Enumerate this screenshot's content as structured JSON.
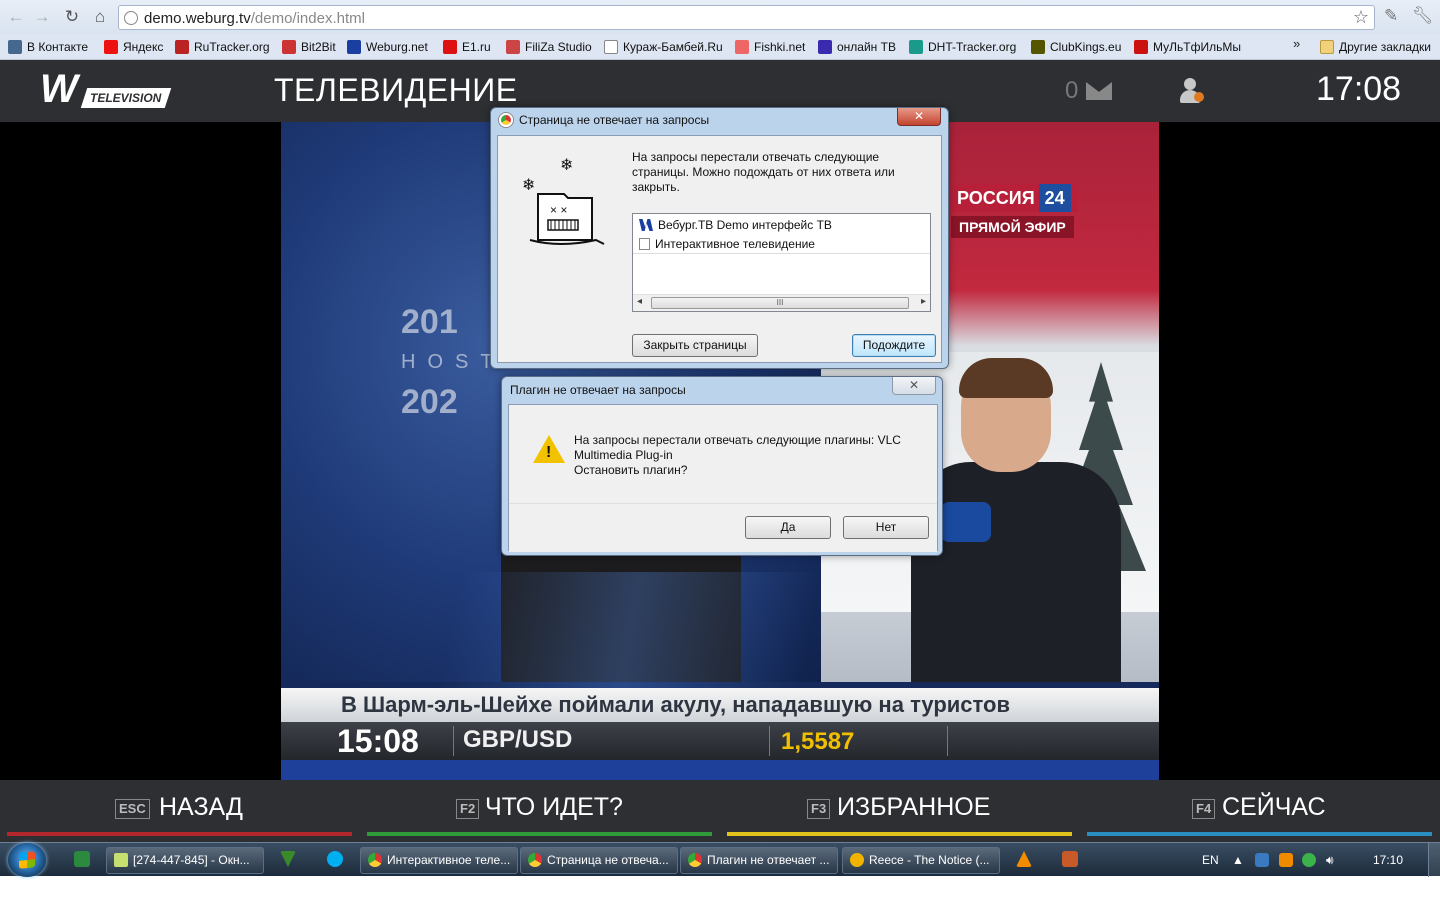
{
  "browser": {
    "url_host": "demo.weburg.tv",
    "url_path": "/demo/index.html",
    "bookmarks": [
      {
        "label": "В Контакте",
        "color": "#45688e"
      },
      {
        "label": "Яндекс",
        "color": "#e11"
      },
      {
        "label": "RuTracker.org",
        "color": "#b22"
      },
      {
        "label": "Bit2Bit",
        "color": "#c33"
      },
      {
        "label": "Weburg.net",
        "color": "#1b3fa0"
      },
      {
        "label": "E1.ru",
        "color": "#d11"
      },
      {
        "label": "FiliZa Studio",
        "color": "#c44"
      },
      {
        "label": "Кураж-Бамбей.Ru",
        "color": "#ffffff"
      },
      {
        "label": "Fishki.net",
        "color": "#e66"
      },
      {
        "label": "онлайн ТВ",
        "color": "#3a2ab0"
      },
      {
        "label": "DHT-Tracker.org",
        "color": "#1a9a8a"
      },
      {
        "label": "ClubKings.eu",
        "color": "#555500"
      },
      {
        "label": "МуЛьТфИльМы",
        "color": "#c11"
      }
    ],
    "bookmarks_more": "»",
    "other_bookmarks": "Другие закладки"
  },
  "tv": {
    "logo_text": "TELEVISION",
    "title": "ТЕЛЕВИДЕНИЕ",
    "message_count": "0",
    "clock": "17:08"
  },
  "video": {
    "channel_name": "РОССИЯ",
    "channel_number": "24",
    "live_label": "ПРЯМОЙ ЭФИР",
    "banner_year1": "201",
    "banner_host": "HOST",
    "banner_year2": "202",
    "headline": "В Шарм-эль-Шейхе поймали акулу, нападавшую на туристов",
    "ticker_time": "15:08",
    "ticker_pair": "GBP/USD",
    "ticker_value": "1,5587"
  },
  "dialog_pages": {
    "title": "Страница не отвечает на запросы",
    "close": "✕",
    "message": "На запросы перестали отвечать следующие страницы. Можно подождать от них ответа или закрыть.",
    "list": [
      "Вебург.ТВ Demo интерфейс ТВ",
      "Интерактивное телевидение"
    ],
    "scroll_grip": "III",
    "btn_close": "Закрыть страницы",
    "btn_wait": "Подождите"
  },
  "dialog_plugin": {
    "title": "Плагин не отвечает на запросы",
    "close": "✕",
    "message_line1": "На запросы перестали отвечать следующие плагины: VLC",
    "message_line2": "Multimedia Plug-in",
    "message_line3": "Остановить плагин?",
    "btn_yes": "Да",
    "btn_no": "Нет"
  },
  "bottom_nav": [
    {
      "key": "ESC",
      "label": "НАЗАД",
      "color": "#b3262c"
    },
    {
      "key": "F2",
      "label": "ЧТО ИДЕТ?",
      "color": "#2f9a3a"
    },
    {
      "key": "F3",
      "label": "ИЗБРАННОЕ",
      "color": "#e0c21c"
    },
    {
      "key": "F4",
      "label": "СЕЙЧАС",
      "color": "#2a8fc0"
    }
  ],
  "taskbar": {
    "tasks": [
      {
        "label": "[274-447-845] - Окн...",
        "color": "#c6e070"
      },
      {
        "label": "Интерактивное теле...",
        "color": "#ffffff"
      },
      {
        "label": "Страница не отвеча...",
        "color": "#ffffff"
      },
      {
        "label": "Плагин не отвечает ...",
        "color": "#ffffff"
      },
      {
        "label": "Reece - The Notice (...",
        "color": "#f2b400"
      }
    ],
    "lang": "EN",
    "clock": "17:10"
  }
}
